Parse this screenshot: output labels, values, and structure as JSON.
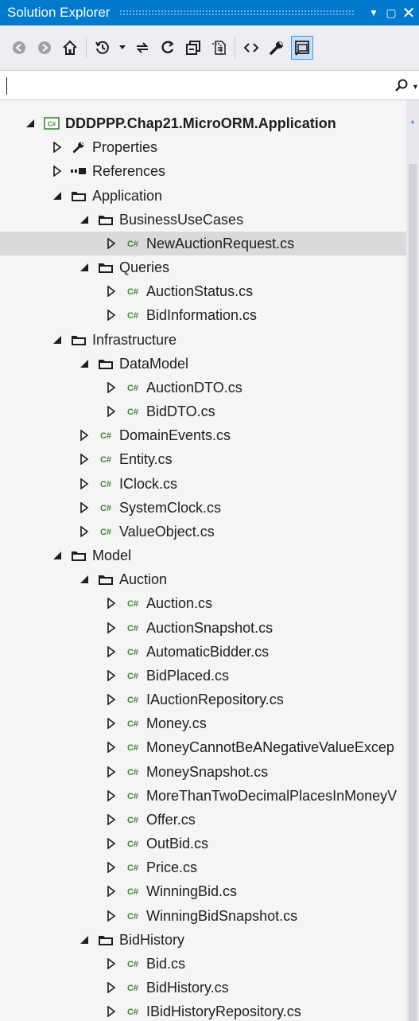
{
  "window": {
    "title": "Solution Explorer",
    "controls": [
      "pin-dropdown",
      "maximize",
      "close"
    ]
  },
  "toolbar": {
    "buttons": [
      "back",
      "forward",
      "home",
      "history",
      "sync",
      "refresh",
      "collapse-all",
      "show-all-files",
      "code",
      "properties",
      "preview"
    ]
  },
  "search": {
    "value": "",
    "icon": "search-icon"
  },
  "tree": [
    {
      "label": "DDDPPP.Chap21.MicroORM.Application",
      "level": 0,
      "kind": "project",
      "expanded": true,
      "bold": true
    },
    {
      "label": "Properties",
      "level": 1,
      "kind": "properties",
      "expanded": false
    },
    {
      "label": "References",
      "level": 1,
      "kind": "references",
      "expanded": false
    },
    {
      "label": "Application",
      "level": 1,
      "kind": "folder",
      "expanded": true
    },
    {
      "label": "BusinessUseCases",
      "level": 2,
      "kind": "folder",
      "expanded": true
    },
    {
      "label": "NewAuctionRequest.cs",
      "level": 3,
      "kind": "cs",
      "expanded": false,
      "selected": true
    },
    {
      "label": "Queries",
      "level": 2,
      "kind": "folder",
      "expanded": true
    },
    {
      "label": "AuctionStatus.cs",
      "level": 3,
      "kind": "cs",
      "expanded": false
    },
    {
      "label": "BidInformation.cs",
      "level": 3,
      "kind": "cs",
      "expanded": false
    },
    {
      "label": "Infrastructure",
      "level": 1,
      "kind": "folder",
      "expanded": true
    },
    {
      "label": "DataModel",
      "level": 2,
      "kind": "folder",
      "expanded": true
    },
    {
      "label": "AuctionDTO.cs",
      "level": 3,
      "kind": "cs",
      "expanded": false
    },
    {
      "label": "BidDTO.cs",
      "level": 3,
      "kind": "cs",
      "expanded": false
    },
    {
      "label": "DomainEvents.cs",
      "level": 2,
      "kind": "cs",
      "expanded": false
    },
    {
      "label": "Entity.cs",
      "level": 2,
      "kind": "cs",
      "expanded": false
    },
    {
      "label": "IClock.cs",
      "level": 2,
      "kind": "cs",
      "expanded": false
    },
    {
      "label": "SystemClock.cs",
      "level": 2,
      "kind": "cs",
      "expanded": false
    },
    {
      "label": "ValueObject.cs",
      "level": 2,
      "kind": "cs",
      "expanded": false
    },
    {
      "label": "Model",
      "level": 1,
      "kind": "folder",
      "expanded": true
    },
    {
      "label": "Auction",
      "level": 2,
      "kind": "folder",
      "expanded": true
    },
    {
      "label": "Auction.cs",
      "level": 3,
      "kind": "cs",
      "expanded": false
    },
    {
      "label": "AuctionSnapshot.cs",
      "level": 3,
      "kind": "cs",
      "expanded": false
    },
    {
      "label": "AutomaticBidder.cs",
      "level": 3,
      "kind": "cs",
      "expanded": false
    },
    {
      "label": "BidPlaced.cs",
      "level": 3,
      "kind": "cs",
      "expanded": false
    },
    {
      "label": "IAuctionRepository.cs",
      "level": 3,
      "kind": "cs",
      "expanded": false
    },
    {
      "label": "Money.cs",
      "level": 3,
      "kind": "cs",
      "expanded": false
    },
    {
      "label": "MoneyCannotBeANegativeValueExcep",
      "level": 3,
      "kind": "cs",
      "expanded": false
    },
    {
      "label": "MoneySnapshot.cs",
      "level": 3,
      "kind": "cs",
      "expanded": false
    },
    {
      "label": "MoreThanTwoDecimalPlacesInMoneyV",
      "level": 3,
      "kind": "cs",
      "expanded": false
    },
    {
      "label": "Offer.cs",
      "level": 3,
      "kind": "cs",
      "expanded": false
    },
    {
      "label": "OutBid.cs",
      "level": 3,
      "kind": "cs",
      "expanded": false
    },
    {
      "label": "Price.cs",
      "level": 3,
      "kind": "cs",
      "expanded": false
    },
    {
      "label": "WinningBid.cs",
      "level": 3,
      "kind": "cs",
      "expanded": false
    },
    {
      "label": "WinningBidSnapshot.cs",
      "level": 3,
      "kind": "cs",
      "expanded": false
    },
    {
      "label": "BidHistory",
      "level": 2,
      "kind": "folder",
      "expanded": true
    },
    {
      "label": "Bid.cs",
      "level": 3,
      "kind": "cs",
      "expanded": false
    },
    {
      "label": "BidHistory.cs",
      "level": 3,
      "kind": "cs",
      "expanded": false
    },
    {
      "label": "IBidHistoryRepository.cs",
      "level": 3,
      "kind": "cs",
      "expanded": false
    }
  ],
  "colors": {
    "titlebar": "#007acc",
    "selection": "#dadadc",
    "cs_icon": "#388a34",
    "accent": "#3399ff"
  }
}
